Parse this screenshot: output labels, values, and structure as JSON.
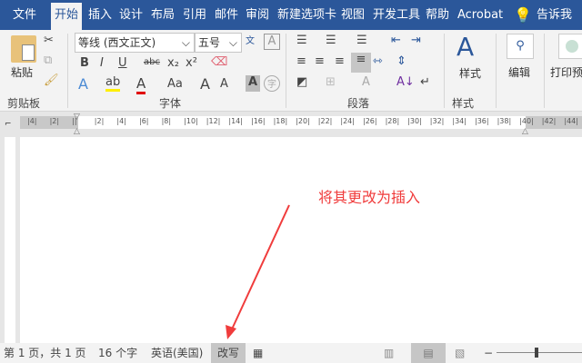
{
  "tabs": [
    "文件",
    "开始",
    "插入",
    "设计",
    "布局",
    "引用",
    "邮件",
    "审阅",
    "新建选项卡",
    "视图",
    "开发工具",
    "帮助",
    "Acrobat"
  ],
  "tell_me": "告诉我",
  "clipboard": {
    "paste": "粘贴",
    "group": "剪贴板"
  },
  "font": {
    "name": "等线 (西文正文)",
    "size": "五号",
    "group": "字体",
    "bold": "B",
    "italic": "I",
    "underline": "U",
    "strike": "abc",
    "sub": "x₂",
    "sup": "x²",
    "grow": "A",
    "shrink": "A",
    "case": "Aa",
    "color_a": "A"
  },
  "paragraph": {
    "group": "段落"
  },
  "styles": {
    "label": "样式",
    "group": "样式"
  },
  "editing": {
    "label": "编辑"
  },
  "print_preview": {
    "label": "打印预"
  },
  "ruler_ticks": [
    "4",
    "2",
    "",
    "2",
    "4",
    "6",
    "8",
    "10",
    "12",
    "14",
    "16",
    "18",
    "20",
    "22",
    "24",
    "26",
    "28",
    "30",
    "32",
    "34",
    "36",
    "38",
    "40",
    "42",
    "44"
  ],
  "annotation": "将其更改为插入",
  "status": {
    "page": "第 1 页，共 1 页",
    "words": "16 个字",
    "language": "英语(美国)",
    "mode": "改写"
  },
  "colors": {
    "accent": "#2b579a",
    "annotation": "#f03c3c"
  }
}
